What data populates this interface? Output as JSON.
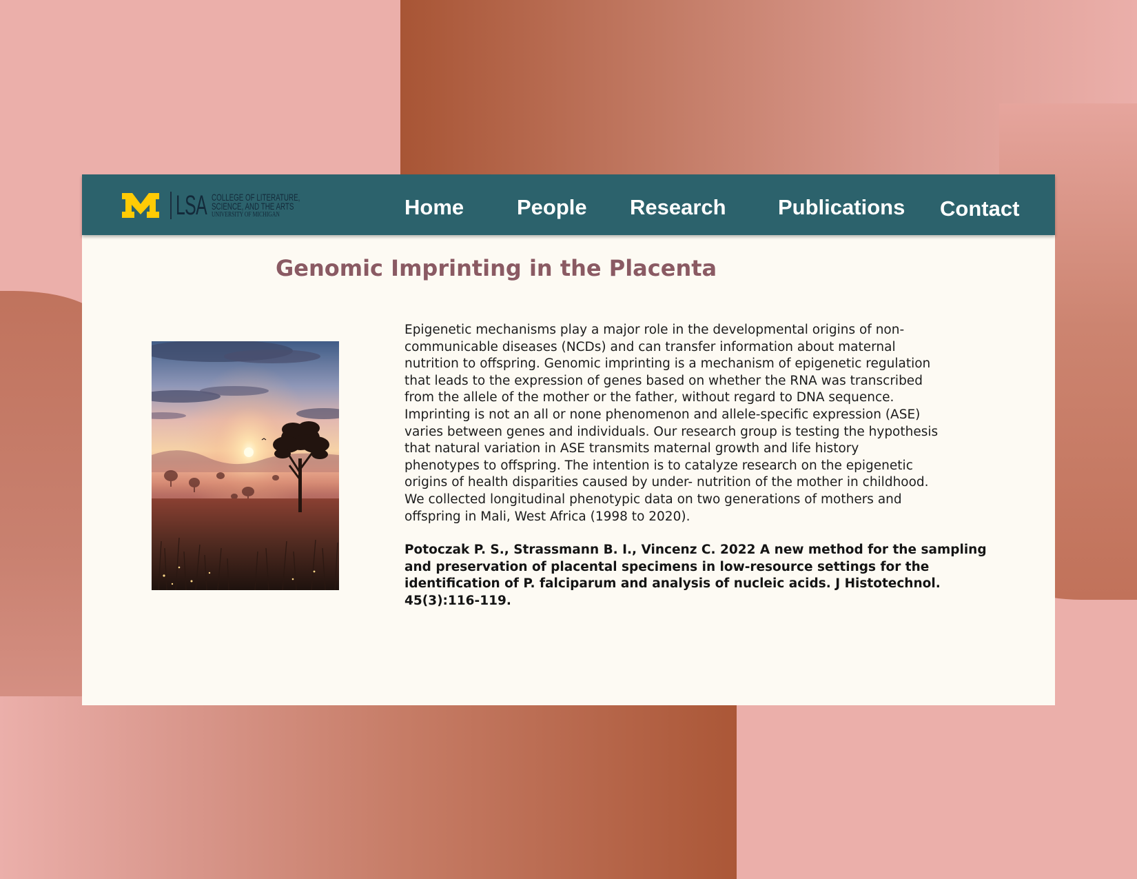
{
  "nav": {
    "logo": {
      "letter": "M",
      "lsa": "LSA",
      "college_lines": [
        "COLLEGE OF LITERATURE,",
        "SCIENCE, AND THE ARTS",
        "UNIVERSITY OF MICHIGAN"
      ]
    },
    "links": [
      "Home",
      "People",
      "Research",
      "Publications",
      "Contact"
    ]
  },
  "page": {
    "title": "Genomic Imprinting in the Placenta",
    "abstract": "Epigenetic mechanisms play a major role in the developmental origins of non-\ncommunicable diseases (NCDs) and can transfer information about maternal\nnutrition to offspring. Genomic imprinting is a mechanism of epigenetic regulation\nthat leads to the expression of genes based on whether the RNA was transcribed\nfrom the allele of the mother or the father, without regard to DNA sequence.\nImprinting is not an all or none phenomenon and allele-specific expression (ASE)\nvaries between genes and individuals. Our research group is testing the hypothesis\nthat natural variation in ASE transmits maternal growth and life history\nphenotypes to offspring. The intention is to catalyze research on the epigenetic\norigins of health disparities caused by under- nutrition of the mother in childhood.\nWe collected longitudinal phenotypic data on two generations of mothers and\noffspring in Mali, West Africa (1998 to 2020).",
    "citation": "Potoczak P. S., Strassmann B. I., Vincenz C. 2022 A new method for the sampling\nand preservation of placental specimens in low-resource settings for the\nidentification of P. falciparum and analysis of nucleic acids. J Histotechnol.\n45(3):116-119."
  },
  "colors": {
    "navbar": "#2c626c",
    "title": "#8a5a63",
    "logo_maize": "#ffcb05",
    "logo_blue": "#132a3a",
    "card": "#fdfaf3"
  }
}
